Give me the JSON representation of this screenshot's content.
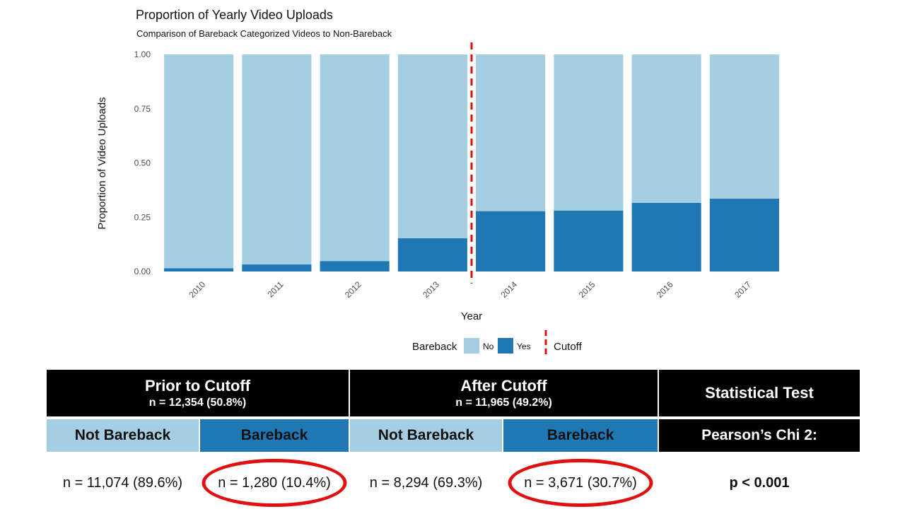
{
  "chart_data": {
    "type": "bar",
    "stacked": true,
    "title": "Proportion of Yearly Video Uploads",
    "subtitle": "Comparison of Bareback Categorized Videos to Non-Bareback",
    "xlabel": "Year",
    "ylabel": "Proportion of Video Uploads",
    "ylim": [
      0,
      1
    ],
    "yticks": [
      "0.00",
      "0.25",
      "0.50",
      "0.75",
      "1.00"
    ],
    "categories": [
      "2010",
      "2011",
      "2012",
      "2013",
      "2014",
      "2015",
      "2016",
      "2017"
    ],
    "series": [
      {
        "name": "Yes",
        "color": "#1f78b4",
        "values": [
          0.015,
          0.033,
          0.048,
          0.153,
          0.278,
          0.281,
          0.316,
          0.336
        ]
      },
      {
        "name": "No",
        "color": "#a6cee3",
        "values": [
          0.985,
          0.967,
          0.952,
          0.847,
          0.722,
          0.719,
          0.684,
          0.664
        ]
      }
    ],
    "cutoff": {
      "between": [
        "2013",
        "2014"
      ],
      "color": "#e01010"
    },
    "legend": {
      "placement": "bottom",
      "title": "Bareback",
      "items": [
        {
          "label": "No",
          "color": "#a6cee3"
        },
        {
          "label": "Yes",
          "color": "#1f78b4"
        }
      ],
      "cutoff_label": "Cutoff"
    },
    "grid": false
  },
  "table": {
    "prior_title": "Prior to Cutoff",
    "prior_n": "n = 12,354 (50.8%)",
    "after_title": "After Cutoff",
    "after_n": "n = 11,965 (49.2%)",
    "test_title": "Statistical Test",
    "sub_not_bareback": "Not Bareback",
    "sub_bareback": "Bareback",
    "test_name": "Pearson’s Chi 2:",
    "prior_not": "n = 11,074 (89.6%)",
    "prior_bb": "n = 1,280 (10.4%)",
    "after_not": "n = 8,294 (69.3%)",
    "after_bb": "n = 3,671 (30.7%)",
    "p_value": "p < 0.001"
  },
  "colors": {
    "light_blue": "#a6cee3",
    "dark_blue": "#1f78b4",
    "highlight_red": "#e01010",
    "header_black": "#000000"
  }
}
